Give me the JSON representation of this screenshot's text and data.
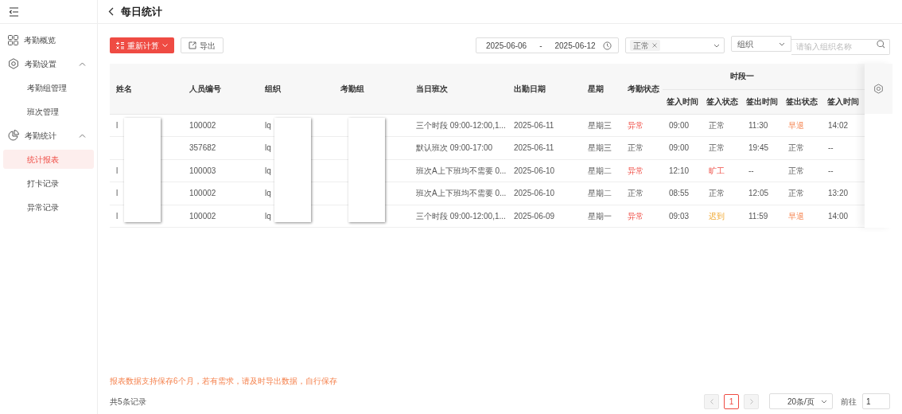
{
  "page_title": "每日统计",
  "sidebar": {
    "items": [
      {
        "label": "考勤概览",
        "selected": false
      },
      {
        "label": "考勤设置",
        "expanded": true,
        "selected": false,
        "children": [
          {
            "label": "考勤组管理",
            "selected": false
          },
          {
            "label": "班次管理",
            "selected": false
          }
        ]
      },
      {
        "label": "考勤统计",
        "expanded": true,
        "selected": false,
        "children": [
          {
            "label": "统计报表",
            "selected": true
          },
          {
            "label": "打卡记录",
            "selected": false
          },
          {
            "label": "异常记录",
            "selected": false
          }
        ]
      }
    ]
  },
  "toolbar": {
    "recalc_button": "重新计算",
    "export_button": "导出",
    "date_start": "2025-06-06",
    "date_separator": "-",
    "date_end": "2025-06-12",
    "status_tags": [
      "正常"
    ],
    "org_select": "组织",
    "org_search_placeholder": "请输入组织名称"
  },
  "table": {
    "columns": [
      "姓名",
      "人员编号",
      "组织",
      "考勤组",
      "当日班次",
      "出勤日期",
      "星期",
      "考勤状态"
    ],
    "group_header": "时段一",
    "sub_columns": [
      "签入时间",
      "签入状态",
      "签出时间",
      "签出状态",
      "签入时间"
    ],
    "rows": [
      {
        "name": "l",
        "id": "100002",
        "org": "lq",
        "shift": "三个时段 09:00-12:00,1...",
        "date": "2025-06-11",
        "weekday": "星期三",
        "status": {
          "text": "异常",
          "kind": "abnormal"
        },
        "cells": [
          {
            "text": "09:00",
            "kind": "plain"
          },
          {
            "text": "正常",
            "kind": "normal"
          },
          {
            "text": "11:30",
            "kind": "plain"
          },
          {
            "text": "早退",
            "kind": "early"
          },
          {
            "text": "14:02",
            "kind": "plain"
          }
        ]
      },
      {
        "id": "357682",
        "org": "lq",
        "shift": "默认班次 09:00-17:00",
        "date": "2025-06-11",
        "weekday": "星期三",
        "status": {
          "text": "正常",
          "kind": "normal"
        },
        "cells": [
          {
            "text": "09:00",
            "kind": "plain"
          },
          {
            "text": "正常",
            "kind": "normal"
          },
          {
            "text": "19:45",
            "kind": "plain"
          },
          {
            "text": "正常",
            "kind": "normal"
          },
          {
            "text": "--",
            "kind": "plain"
          }
        ]
      },
      {
        "name": "l",
        "id": "100003",
        "org": "lq",
        "shift": "班次A上下班均不需要 0...",
        "date": "2025-06-10",
        "weekday": "星期二",
        "status": {
          "text": "异常",
          "kind": "abnormal"
        },
        "cells": [
          {
            "text": "12:10",
            "kind": "plain"
          },
          {
            "text": "旷工",
            "kind": "absent"
          },
          {
            "text": "--",
            "kind": "plain"
          },
          {
            "text": "正常",
            "kind": "normal"
          },
          {
            "text": "--",
            "kind": "plain"
          }
        ]
      },
      {
        "name": "l",
        "id": "100002",
        "org": "lq",
        "shift": "班次A上下班均不需要 0...",
        "date": "2025-06-10",
        "weekday": "星期二",
        "status": {
          "text": "正常",
          "kind": "normal"
        },
        "cells": [
          {
            "text": "08:55",
            "kind": "plain"
          },
          {
            "text": "正常",
            "kind": "normal"
          },
          {
            "text": "12:05",
            "kind": "plain"
          },
          {
            "text": "正常",
            "kind": "normal"
          },
          {
            "text": "13:20",
            "kind": "plain"
          }
        ]
      },
      {
        "name": "l",
        "id": "100002",
        "org": "lq",
        "shift": "三个时段 09:00-12:00,1...",
        "date": "2025-06-09",
        "weekday": "星期一",
        "status": {
          "text": "异常",
          "kind": "abnormal"
        },
        "cells": [
          {
            "text": "09:03",
            "kind": "plain"
          },
          {
            "text": "迟到",
            "kind": "late"
          },
          {
            "text": "11:59",
            "kind": "plain"
          },
          {
            "text": "早退",
            "kind": "early"
          },
          {
            "text": "14:00",
            "kind": "plain"
          }
        ]
      }
    ]
  },
  "notice": "报表数据支持保存6个月，若有需求，请及时导出数据，自行保存",
  "total": "共5条记录",
  "pagination": {
    "pages": [
      {
        "label": "1",
        "selected": true
      }
    ],
    "page_size": "20条/页",
    "goto_label": "前往",
    "goto_value": "1"
  }
}
